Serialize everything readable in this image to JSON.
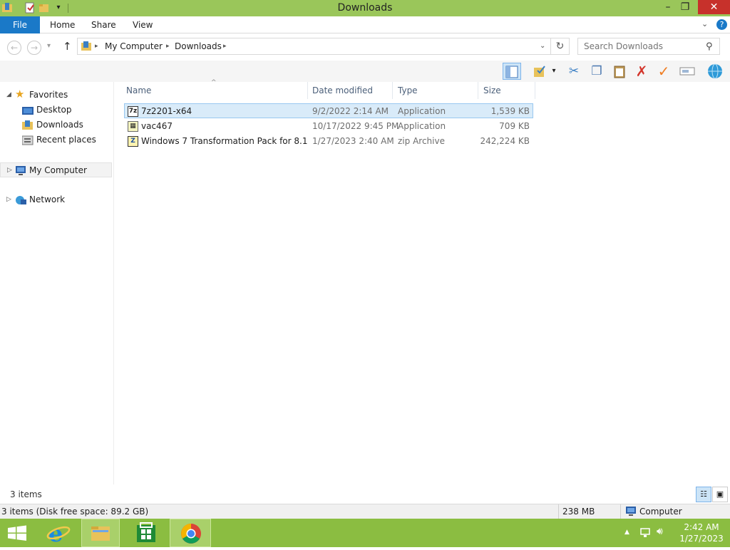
{
  "window": {
    "title": "Downloads"
  },
  "tabs": {
    "file": "File",
    "home": "Home",
    "share": "Share",
    "view": "View"
  },
  "address": {
    "crumb1": "My Computer",
    "crumb2": "Downloads"
  },
  "search": {
    "placeholder": "Search Downloads"
  },
  "nav": {
    "favorites": "Favorites",
    "desktop": "Desktop",
    "downloads": "Downloads",
    "recent": "Recent places",
    "computer": "My Computer",
    "network": "Network"
  },
  "columns": {
    "name": "Name",
    "date": "Date modified",
    "type": "Type",
    "size": "Size"
  },
  "files": [
    {
      "name": "7z2201-x64",
      "date": "9/2/2022 2:14 AM",
      "type": "Application",
      "size": "1,539 KB",
      "icon": "7z-icon"
    },
    {
      "name": "vac467",
      "date": "10/17/2022 9:45 PM",
      "type": "Application",
      "size": "709 KB",
      "icon": "installer-icon"
    },
    {
      "name": "Windows 7 Transformation Pack for 8.1",
      "date": "1/27/2023 2:40 AM",
      "type": "zip Archive",
      "size": "242,224 KB",
      "icon": "zip-icon"
    }
  ],
  "status": {
    "count": "3 items",
    "left": "3 items (Disk free space: 89.2 GB)",
    "size": "238 MB",
    "location": "Computer"
  },
  "taskbar": {
    "time": "2:42 AM",
    "date": "1/27/2023"
  },
  "colors": {
    "titlebar": "#9ac65a",
    "taskbar": "#8bbd41",
    "file_tab": "#1a79c8",
    "close": "#c7312b",
    "selection": "#d9ebf9"
  }
}
